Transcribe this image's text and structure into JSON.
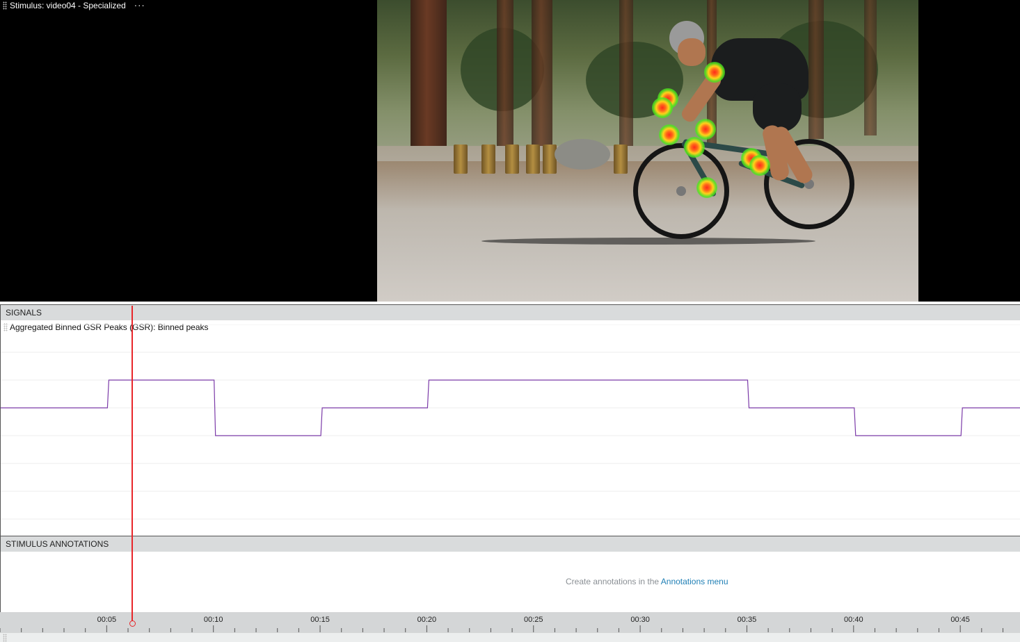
{
  "stimulus": {
    "title": "Stimulus: video04 - Specialized",
    "more_label": "···"
  },
  "signals": {
    "header": "SIGNALS",
    "legend": "Aggregated Binned GSR Peaks (GSR): Binned peaks",
    "line_color": "#7b3aa8"
  },
  "annotations": {
    "header": "STIMULUS ANNOTATIONS",
    "message": "Create annotations in the ",
    "link": "Annotations menu"
  },
  "timeline": {
    "tick_labels": [
      "00:05",
      "00:10",
      "00:15",
      "00:20",
      "00:25",
      "00:30",
      "00:35",
      "00:40",
      "00:45"
    ],
    "playhead_color": "#e8262a",
    "playhead_time_s": 6.2
  },
  "chart_data": {
    "type": "line",
    "series": [
      {
        "name": "Aggregated Binned GSR Peaks (GSR): Binned peaks",
        "x": [
          0,
          5,
          5,
          10,
          10,
          15,
          15,
          20,
          20,
          35,
          35,
          40,
          40,
          45,
          45,
          48
        ],
        "y": [
          0,
          0,
          1,
          1,
          -1,
          -1,
          0,
          0,
          1,
          1,
          0,
          0,
          -1,
          -1,
          0,
          0
        ]
      }
    ],
    "xlim": [
      0,
      48
    ],
    "ylim": [
      -4,
      3
    ],
    "grid": true
  }
}
